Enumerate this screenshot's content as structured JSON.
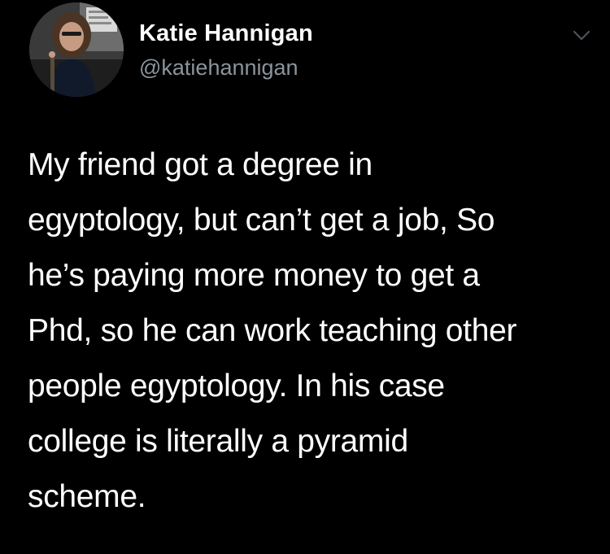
{
  "tweet": {
    "author": {
      "display_name": "Katie Hannigan",
      "handle": "@katiehannigan",
      "avatar_icon": "profile-photo"
    },
    "menu_icon": "chevron-down-icon",
    "text_lines": [
      "My friend got a degree in",
      "egyptology, but can’t get a job, So",
      "he’s paying more money to get a",
      "Phd, so he can work teaching other",
      "people egyptology.  In his case",
      "college is literally a pyramid",
      "scheme."
    ]
  },
  "colors": {
    "background": "#000000",
    "text": "#ffffff",
    "handle": "#8a949c"
  }
}
